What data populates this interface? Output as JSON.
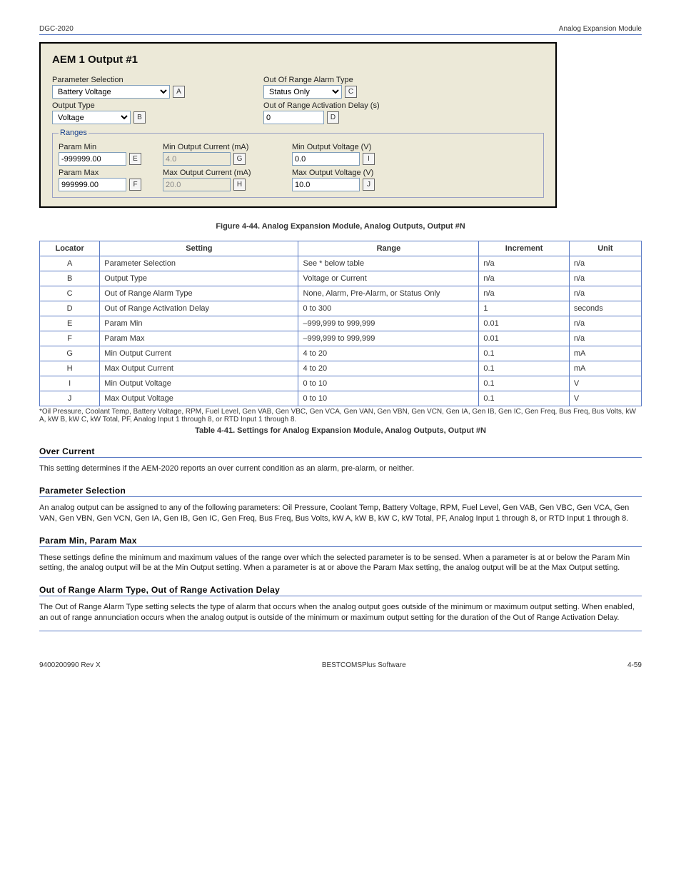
{
  "header": {
    "model": "DGC-2020",
    "subject": "Analog Expansion Module",
    "revision": "9400200990 Rev X"
  },
  "panel": {
    "title": "AEM 1 Output #1",
    "parameter_selection": {
      "label": "Parameter Selection",
      "value": "Battery Voltage",
      "badge": "A"
    },
    "output_type": {
      "label": "Output Type",
      "value": "Voltage",
      "badge": "B"
    },
    "alarm_type": {
      "label": "Out Of Range Alarm Type",
      "value": "Status Only",
      "badge": "C"
    },
    "activation_delay": {
      "label": "Out of Range Activation Delay (s)",
      "value": "0",
      "badge": "D"
    },
    "ranges_legend": "Ranges",
    "param_min": {
      "label": "Param Min",
      "value": "-999999.00",
      "badge": "E"
    },
    "param_max": {
      "label": "Param Max",
      "value": "999999.00",
      "badge": "F"
    },
    "min_out_current": {
      "label": "Min Output Current (mA)",
      "value": "4.0",
      "badge": "G"
    },
    "max_out_current": {
      "label": "Max Output Current (mA)",
      "value": "20.0",
      "badge": "H"
    },
    "min_out_voltage": {
      "label": "Min Output Voltage (V)",
      "value": "0.0",
      "badge": "I"
    },
    "max_out_voltage": {
      "label": "Max Output Voltage (V)",
      "value": "10.0",
      "badge": "J"
    }
  },
  "figure_caption": "Figure 4-44. Analog Expansion Module, Analog Outputs, Output #N",
  "table": {
    "headers": [
      "Locator",
      "Setting",
      "Range",
      "Increment",
      "Unit"
    ],
    "rows": [
      {
        "loc": "A",
        "setting": "Parameter Selection",
        "range": "See * below table",
        "inc": "n/a",
        "unit": "n/a"
      },
      {
        "loc": "B",
        "setting": "Output Type",
        "range": "Voltage or Current",
        "inc": "n/a",
        "unit": "n/a"
      },
      {
        "loc": "C",
        "setting": "Out of Range Alarm Type",
        "range": "None, Alarm, Pre-Alarm, or Status Only",
        "inc": "n/a",
        "unit": "n/a"
      },
      {
        "loc": "D",
        "setting": "Out of Range Activation Delay",
        "range": "0 to 300",
        "inc": "1",
        "unit": "seconds"
      },
      {
        "loc": "E",
        "setting": "Param Min",
        "range": "–999,999 to 999,999",
        "inc": "0.01",
        "unit": "n/a"
      },
      {
        "loc": "F",
        "setting": "Param Max",
        "range": "–999,999 to 999,999",
        "inc": "0.01",
        "unit": "n/a"
      },
      {
        "loc": "G",
        "setting": "Min Output Current",
        "range": "4 to 20",
        "inc": "0.1",
        "unit": "mA"
      },
      {
        "loc": "H",
        "setting": "Max Output Current",
        "range": "4 to 20",
        "inc": "0.1",
        "unit": "mA"
      },
      {
        "loc": "I",
        "setting": "Min Output Voltage",
        "range": "0 to 10",
        "inc": "0.1",
        "unit": "V"
      },
      {
        "loc": "J",
        "setting": "Max Output Voltage",
        "range": "0 to 10",
        "inc": "0.1",
        "unit": "V"
      }
    ]
  },
  "footnote": "*Oil Pressure, Coolant Temp, Battery Voltage, RPM, Fuel Level, Gen VAB, Gen VBC, Gen VCA, Gen VAN, Gen VBN, Gen VCN, Gen IA, Gen IB, Gen IC, Gen Freq, Bus Freq, Bus Volts, kW A, kW B, kW C, kW Total, PF, Analog Input 1 through 8, or RTD Input 1 through 8.",
  "table_caption": "Table 4-41. Settings for Analog Expansion Module, Analog Outputs, Output #N",
  "sections": {
    "s1": {
      "title": "Over Current",
      "body": "This setting determines if the AEM-2020 reports an over current condition as an alarm, pre-alarm, or neither."
    },
    "s2": {
      "title": "Parameter Selection",
      "body": "An analog output can be assigned to any of the following parameters: Oil Pressure, Coolant Temp, Battery Voltage, RPM, Fuel Level, Gen VAB, Gen VBC, Gen VCA, Gen VAN, Gen VBN, Gen VCN, Gen IA, Gen IB, Gen IC, Gen Freq, Bus Freq, Bus Volts, kW A, kW B, kW C, kW Total, PF, Analog Input 1 through 8, or RTD Input 1 through 8."
    },
    "s3": {
      "title": "Param Min, Param Max",
      "body": "These settings define the minimum and maximum values of the range over which the selected parameter is to be sensed. When a parameter is at or below the Param Min setting, the analog output will be at the Min Output setting. When a parameter is at or above the Param Max setting, the analog output will be at the Max Output setting."
    },
    "s4": {
      "title": "Out of Range Alarm Type, Out of Range Activation Delay",
      "body": "The Out of Range Alarm Type setting selects the type of alarm that occurs when the analog output goes outside of the minimum or maximum output setting. When enabled, an out of range annunciation occurs when the analog output is outside of the minimum or maximum output setting for the duration of the Out of Range Activation Delay."
    }
  },
  "footer": {
    "rev": "9400200990 Rev X",
    "title": "BESTCOMSPlus Software",
    "page": "4-59"
  }
}
